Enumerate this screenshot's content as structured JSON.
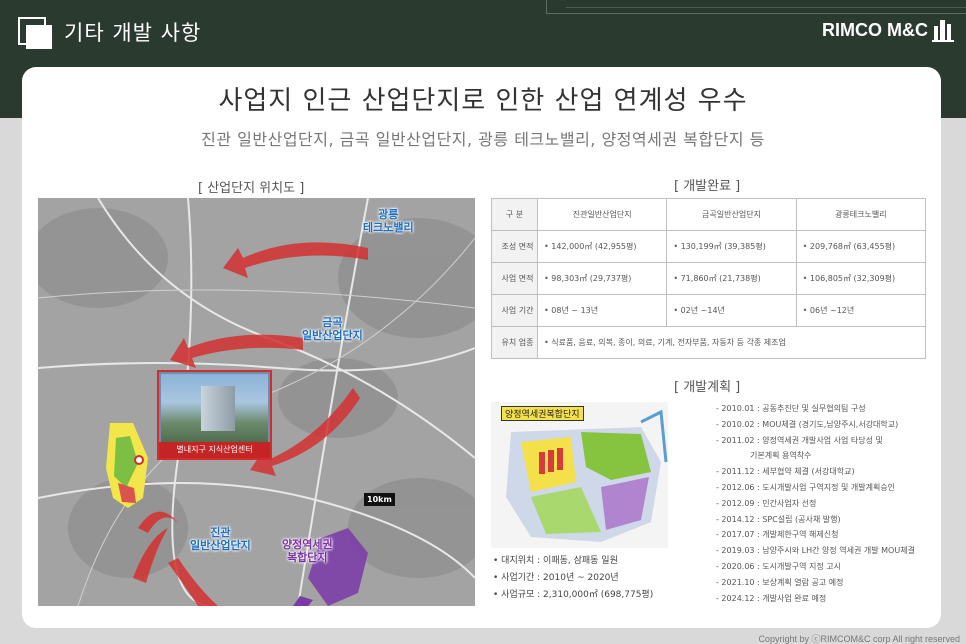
{
  "header": {
    "title": "기타 개발 사항",
    "brand": "RIMCO M&C"
  },
  "headline": "사업지 인근 산업단지로 인한 산업 연계성 우수",
  "subheadline": "진관 일반산업단지, 금곡 일반산업단지, 광릉 테크노밸리, 양정역세권 복합단지 등",
  "map_section": {
    "label": "[ 산업단지 위치도 ]",
    "labels": {
      "gwangneung": "광릉\n테크노밸리",
      "geumgok": "금곡\n일반산업단지",
      "jingwan": "진관\n일반산업단지",
      "yangjeong": "양정역세권\n복합단지"
    },
    "popup_caption": "별내지구 지식산업센터",
    "scale": "10km"
  },
  "complete_section": {
    "label": "[ 개발완료 ]",
    "headers": [
      "구 분",
      "진관일반산업단지",
      "금곡일반산업단지",
      "광릉테크노밸리"
    ],
    "rows": [
      {
        "label": "조성 면적",
        "cells": [
          "• 142,000㎡ (42,955평)",
          "• 130,199㎡ (39,385평)",
          "• 209,768㎡ (63,455평)"
        ]
      },
      {
        "label": "사업 면적",
        "cells": [
          "• 98,303㎡ (29,737평)",
          "• 71,860㎡ (21,738평)",
          "• 106,805㎡ (32,309평)"
        ]
      },
      {
        "label": "사업 기간",
        "cells": [
          "• 08년 ~ 13년",
          "• 02년 ~14년",
          "• 06년 ~12년"
        ]
      },
      {
        "label": "유치 업종",
        "span_text": "• 식료품, 음료, 의복, 종이, 의료, 기계, 전자부품, 자동차 등 각종 제조업"
      }
    ]
  },
  "plan_section": {
    "label": "[ 개발계획 ]",
    "image_title": "양정역세권복합단지",
    "bullets": [
      "• 대지위치 : 이패동, 삼패동 일원",
      "• 사업기간 : 2010년 ~ 2020년",
      "• 사업규모 : 2,310,000㎡ (698,775평)"
    ],
    "timeline": [
      "- 2010.01 : 공동추진단 및 실무협의팀 구성",
      "- 2010.02 : MOU체결 (경기도,남양주시,서강대학교)",
      "- 2011.02 : 양정역세권 개발사업 사업 타당성 및",
      "기본계획 용역착수",
      "- 2011.12 : 세부협약 체결 (서강대학교)",
      "- 2012.06 : 도시개발사업 구역지정 및 개발계획승인",
      "- 2012.09 : 민간사업자 선정",
      "- 2014.12 : SPC설립 (공사채 발행)",
      "- 2017.07 : 개발제한구역 해제신청",
      "- 2019.03 : 남양주시와 LH간 양정 역세권 개발 MOU체결",
      "- 2020.06 : 도시개발구역 지정 고시",
      "- 2021.10 : 보상계획 열람 공고 예정",
      "- 2024.12 : 개발사업 완료 예정"
    ]
  },
  "copyright": "Copyright by ⓒRIMCOM&C corp All right reserved",
  "colors": {
    "header_bg": "#2b3a2e",
    "accent_red": "#d42b2b",
    "map_blue": "#1e6fc4"
  }
}
